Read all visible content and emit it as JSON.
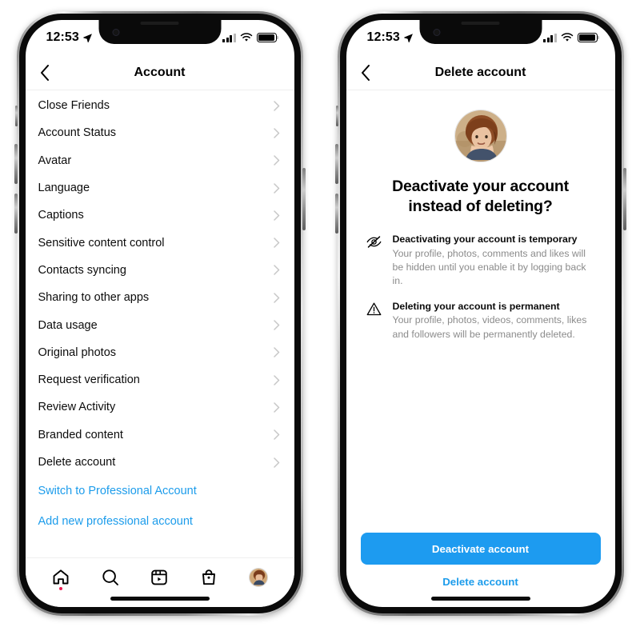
{
  "status_bar": {
    "time": "12:53",
    "location_icon": "location-arrow-icon",
    "signal_icon": "cellular-signal-icon",
    "wifi_icon": "wifi-icon",
    "battery_icon": "battery-icon"
  },
  "left_phone": {
    "nav": {
      "back_icon": "chevron-left-icon",
      "title": "Account"
    },
    "list_items": [
      {
        "label": "Close Friends"
      },
      {
        "label": "Account Status"
      },
      {
        "label": "Avatar"
      },
      {
        "label": "Language"
      },
      {
        "label": "Captions"
      },
      {
        "label": "Sensitive content control"
      },
      {
        "label": "Contacts syncing"
      },
      {
        "label": "Sharing to other apps"
      },
      {
        "label": "Data usage"
      },
      {
        "label": "Original photos"
      },
      {
        "label": "Request verification"
      },
      {
        "label": "Review Activity"
      },
      {
        "label": "Branded content"
      },
      {
        "label": "Delete account"
      }
    ],
    "links": [
      {
        "label": "Switch to Professional Account"
      },
      {
        "label": "Add new professional account"
      }
    ],
    "tabs": [
      {
        "name": "home",
        "icon": "home-icon",
        "badge": true
      },
      {
        "name": "search",
        "icon": "search-icon",
        "badge": false
      },
      {
        "name": "reels",
        "icon": "reels-icon",
        "badge": false
      },
      {
        "name": "shop",
        "icon": "shop-bag-icon",
        "badge": false
      },
      {
        "name": "profile",
        "icon": "profile-avatar-icon",
        "badge": false
      }
    ]
  },
  "right_phone": {
    "nav": {
      "back_icon": "chevron-left-icon",
      "title": "Delete account"
    },
    "avatar_alt": "profile-photo",
    "headline": "Deactivate your account instead of deleting?",
    "bullets": [
      {
        "icon": "eye-slash-icon",
        "heading": "Deactivating your account is temporary",
        "body": "Your profile, photos, comments and likes will be hidden until you enable it by logging back in."
      },
      {
        "icon": "warning-triangle-icon",
        "heading": "Deleting your account is permanent",
        "body": "Your profile, photos, videos, comments, likes and followers will be permanently deleted."
      }
    ],
    "primary_button": "Deactivate account",
    "secondary_button": "Delete account"
  },
  "colors": {
    "link_blue": "#1c9ceb",
    "button_blue": "#1d9bf0",
    "badge_red": "#ec1b52",
    "muted_text": "#8b8b8b",
    "chevron_gray": "#c7c7c7"
  }
}
